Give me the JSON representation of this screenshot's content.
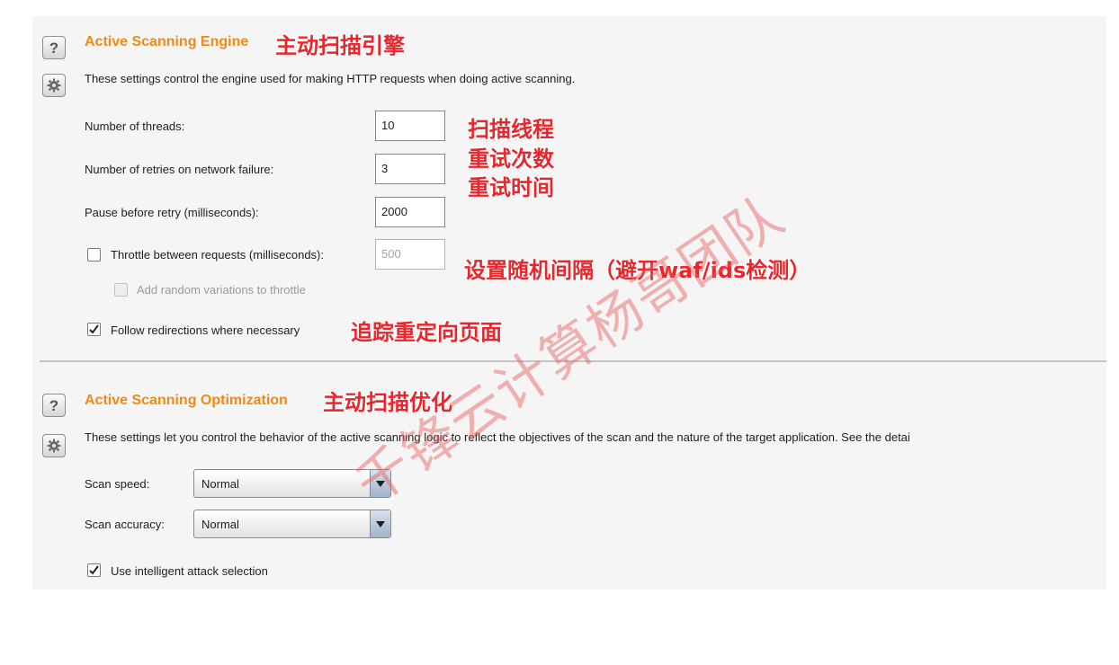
{
  "engine": {
    "title": "Active Scanning Engine",
    "annotation": "主动扫描引擎",
    "description": "These settings control the engine used for making HTTP requests when doing active scanning.",
    "threads_label": "Number of threads:",
    "threads_value": "10",
    "threads_annotation": "扫描线程",
    "retries_label": "Number of retries on network failure:",
    "retries_value": "3",
    "retries_annotation": "重试次数",
    "pause_label": "Pause before retry (milliseconds):",
    "pause_value": "2000",
    "pause_annotation": "重试时间",
    "throttle_label": "Throttle between requests (milliseconds):",
    "throttle_value": "500",
    "throttle_checked": false,
    "throttle_annotation": "设置随机间隔（避开waf/ids检测）",
    "random_label": "Add random variations to throttle",
    "random_checked": false,
    "follow_label": "Follow redirections where necessary",
    "follow_checked": true,
    "follow_annotation": "追踪重定向页面"
  },
  "optimization": {
    "title": "Active Scanning Optimization",
    "annotation": "主动扫描优化",
    "description": "These settings let you control the behavior of the active scanning logic to reflect the objectives of the scan and the nature of the target application. See the detai",
    "speed_label": "Scan speed:",
    "speed_value": "Normal",
    "accuracy_label": "Scan accuracy:",
    "accuracy_value": "Normal",
    "intelligent_label": "Use intelligent attack selection",
    "intelligent_checked": true
  },
  "icons": {
    "help": "?",
    "settings": "gear-icon",
    "dropdown": "chevron-down-icon",
    "check": "checkmark-icon"
  },
  "colors": {
    "section_title": "#f08a14",
    "annotation": "#e8262b",
    "watermark": "#eb5a5a"
  },
  "watermark": "千锋云计算杨哥团队"
}
